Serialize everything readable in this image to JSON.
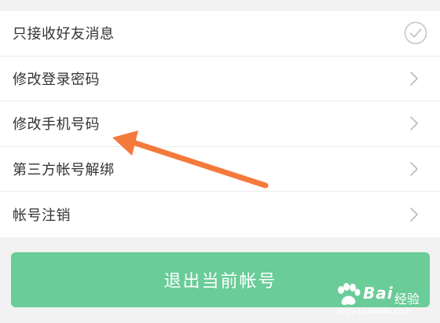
{
  "settings": {
    "items": [
      {
        "label": "只接收好友消息",
        "control": "check-circle-icon"
      },
      {
        "label": "修改登录密码",
        "control": "chevron-right-icon"
      },
      {
        "label": "修改手机号码",
        "control": "chevron-right-icon"
      },
      {
        "label": "第三方帐号解绑",
        "control": "chevron-right-icon"
      },
      {
        "label": "帐号注销",
        "control": "chevron-right-icon"
      }
    ]
  },
  "logout_button": {
    "label": "退出当前帐号",
    "color": "#6acc98"
  },
  "annotation": {
    "icon": "orange-arrow-icon",
    "color": "#f47a3c"
  },
  "watermark": {
    "brand": "Bai",
    "suffix": "经验",
    "url": "jingyan.baidu.com"
  }
}
